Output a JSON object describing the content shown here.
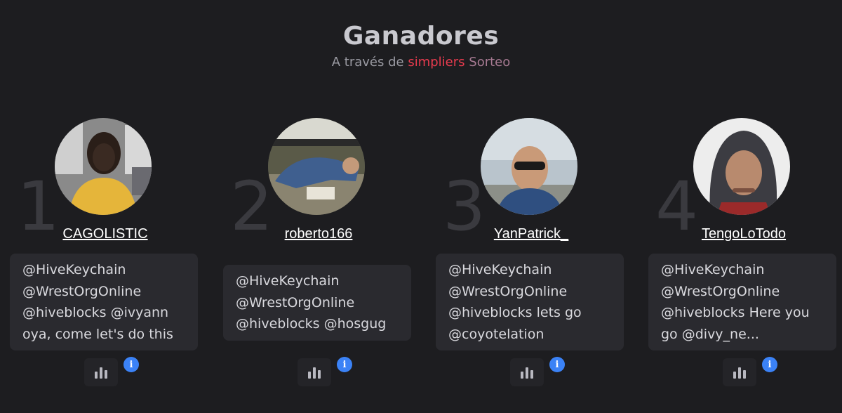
{
  "header": {
    "title": "Ganadores",
    "subtitle_prefix": "A través de",
    "subtitle_brand": "simpliers",
    "subtitle_suffix": "Sorteo"
  },
  "winners": [
    {
      "rank": "1",
      "username": "CAGOLISTIC",
      "comment": "@HiveKeychain @WrestOrgOnline @hiveblocks @ivyann oya, come let's do this"
    },
    {
      "rank": "2",
      "username": "roberto166",
      "comment": "@HiveKeychain @WrestOrgOnline @hiveblocks @hosgug"
    },
    {
      "rank": "3",
      "username": "YanPatrick_",
      "comment": "@HiveKeychain @WrestOrgOnline @hiveblocks lets go @coyotelation"
    },
    {
      "rank": "4",
      "username": "TengoLoTodo",
      "comment": "@HiveKeychain @WrestOrgOnline @hiveblocks Here you go @divy_ne..."
    }
  ],
  "icons": {
    "stats": "bar-chart-icon",
    "info": "info-icon",
    "info_glyph": "i"
  },
  "colors": {
    "background": "#1d1d20",
    "brand": "#e83b4e",
    "info": "#3b82f6",
    "card": "#2a2a2f"
  }
}
